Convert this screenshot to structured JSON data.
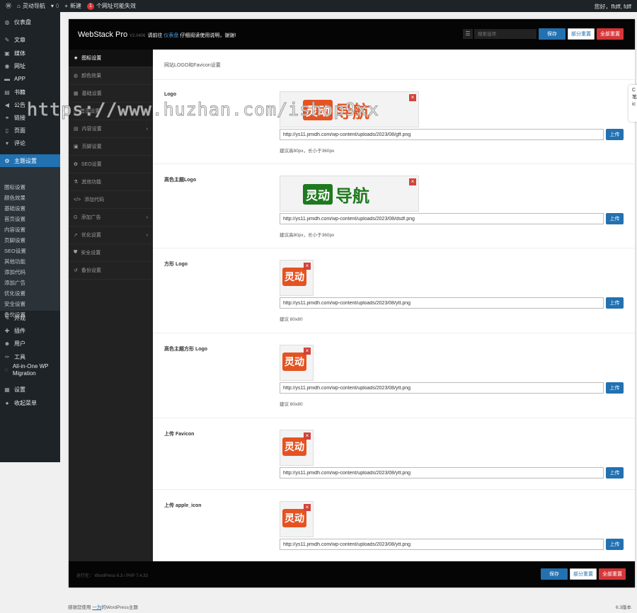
{
  "adminbar": {
    "site": "灵动导航",
    "comments": "0",
    "new": "新建",
    "warn_count": "1",
    "warn": "个网址可能失效",
    "greeting": "您好，ffdff, fdff"
  },
  "wp_menu": [
    {
      "label": "仪表盘",
      "icon": "◍"
    },
    {
      "label": "文章",
      "icon": "✎"
    },
    {
      "label": "媒体",
      "icon": "▣"
    },
    {
      "label": "网址",
      "icon": "◉"
    },
    {
      "label": "APP",
      "icon": "▬"
    },
    {
      "label": "书籍",
      "icon": "▤"
    },
    {
      "label": "公告",
      "icon": "◀"
    },
    {
      "label": "链接",
      "icon": "⚭"
    },
    {
      "label": "页面",
      "icon": "▯"
    },
    {
      "label": "评论",
      "icon": "▾"
    },
    {
      "label": "主题设置",
      "icon": "⚙"
    }
  ],
  "wp_submenu": [
    "图标设置",
    "颜色效果",
    "基础设置",
    "首页设置",
    "内容设置",
    "页脚设置",
    "SEO设置",
    "其他功能",
    "添加代码",
    "添加广告",
    "优化设置",
    "安全设置",
    "备份设置"
  ],
  "wp_menu2": [
    {
      "label": "外观",
      "icon": "✎"
    },
    {
      "label": "插件",
      "icon": "✚"
    },
    {
      "label": "用户",
      "icon": "☻"
    },
    {
      "label": "工具",
      "icon": "✑"
    },
    {
      "label": "All-in-One WP Migration",
      "icon": "◌"
    },
    {
      "label": "设置",
      "icon": "▦"
    },
    {
      "label": "收起菜单",
      "icon": "●"
    }
  ],
  "header": {
    "title": "WebStack Pro",
    "version": "V2.0406",
    "msg_pre": "请前往",
    "msg_link": "仪表盘",
    "msg_post": "仔细阅读使用说明，谢谢!",
    "search_placeholder": "搜索选项",
    "save": "保存",
    "partial_reset": "部分重置",
    "reset_all": "全部重置"
  },
  "nav": [
    {
      "label": "图标设置",
      "icon": "★"
    },
    {
      "label": "颜色效果",
      "icon": "◍"
    },
    {
      "label": "基础设置",
      "icon": "▦"
    },
    {
      "label": "首页设置",
      "icon": "⌂"
    },
    {
      "label": "内容设置",
      "icon": "▤",
      "sub": true
    },
    {
      "label": "页脚设置",
      "icon": "▣"
    },
    {
      "label": "SEO设置",
      "icon": "✿"
    },
    {
      "label": "其他功能",
      "icon": "⚗"
    },
    {
      "label": "添加代码",
      "icon": "</>"
    },
    {
      "label": "添加广告",
      "icon": "G",
      "sub": true
    },
    {
      "label": "优化设置",
      "icon": "➚",
      "sub": true
    },
    {
      "label": "安全设置",
      "icon": "⛊"
    },
    {
      "label": "备份设置",
      "icon": "↺"
    }
  ],
  "section_title": "网站LOGO和Favicon设置",
  "upload_label": "上传",
  "fields": [
    {
      "label": "Logo",
      "url": "http://ys11.jimidh.com/wp-content/uploads/2023/08/gff.png",
      "hint": "建议高80px，长小于360px",
      "kind": "wide",
      "logo_a": "灵动",
      "logo_b": "导航",
      "color": "#e55322"
    },
    {
      "label": "高色主题Logo",
      "url": "http://ys11.jimidh.com/wp-content/uploads/2023/08/dsdf.png",
      "hint": "建议高80px，长小于360px",
      "kind": "wide",
      "logo_a": "灵动",
      "logo_b": "导航",
      "color": "#1f7a1f"
    },
    {
      "label": "方形 Logo",
      "url": "http://ys11.jimidh.com/wp-content/uploads/2023/08/ytt.png",
      "hint": "建议 80x80",
      "kind": "square",
      "logo_a": "灵动",
      "color": "#e55322"
    },
    {
      "label": "高色主题方形 Logo",
      "url": "http://ys11.jimidh.com/wp-content/uploads/2023/08/ytt.png",
      "hint": "建议 80x80",
      "kind": "square",
      "logo_a": "灵动",
      "color": "#e55322"
    },
    {
      "label": "上传 Favicon",
      "url": "http://ys11.jimidh.com/wp-content/uploads/2023/08/ytt.png",
      "kind": "square",
      "logo_a": "灵动",
      "color": "#e55322"
    },
    {
      "label": "上传 apple_icon",
      "url": "http://ys11.jimidh.com/wp-content/uploads/2023/08/ytt.png",
      "kind": "square",
      "logo_a": "灵动",
      "color": "#e55322"
    }
  ],
  "footer": {
    "running": "运行在： WordPress 6.3 / PHP 7.4.33"
  },
  "bottom": {
    "pre": "感谢您使用",
    "link": "一为",
    "post": "的WordPress主题",
    "version": "6.3版本"
  },
  "watermark": "https://www.huzhan.com/ishop9xx"
}
